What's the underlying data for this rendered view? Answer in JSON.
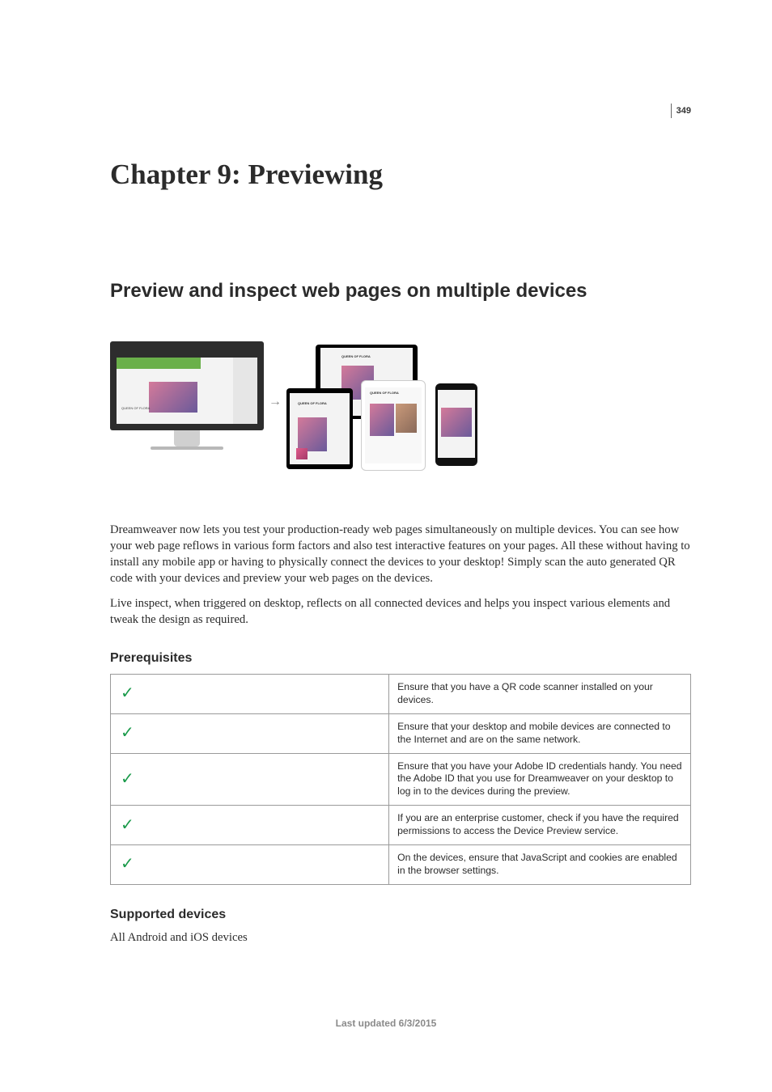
{
  "page_number": "349",
  "chapter_title": "Chapter 9: Previewing",
  "section_title": "Preview and inspect web pages on multiple devices",
  "illustration": {
    "label_main": "QUEEN OF FLORA",
    "label_alt": "QUEEN OF FLORA"
  },
  "paragraphs": {
    "p1": "Dreamweaver now lets you test your production-ready web pages simultaneously on multiple devices. You can see how your web page reflows in various form factors and also test interactive features on your pages. All these without having to install any mobile app or having to physically connect the devices to your desktop! Simply scan the auto generated QR code with your devices and preview your web pages on the devices.",
    "p2": "Live inspect, when triggered on desktop, reflects on all connected devices and helps you inspect various elements and tweak the design as required."
  },
  "prerequisites": {
    "heading": "Prerequisites",
    "rows": [
      {
        "text": "Ensure that you have a QR code scanner installed on your devices."
      },
      {
        "text": "Ensure that your desktop and mobile devices are connected to the Internet and are on the same network."
      },
      {
        "text": "Ensure that you have your Adobe ID credentials handy. You need the Adobe ID that you use for Dreamweaver on your desktop to log in to the devices during the preview."
      },
      {
        "text": "If you are an enterprise customer, check if you have the required permissions to access the Device Preview service."
      },
      {
        "text": "On the devices, ensure that JavaScript and cookies are enabled in the browser settings."
      }
    ]
  },
  "supported_devices": {
    "heading": "Supported devices",
    "text": "All Android and iOS devices"
  },
  "footer": "Last updated 6/3/2015"
}
